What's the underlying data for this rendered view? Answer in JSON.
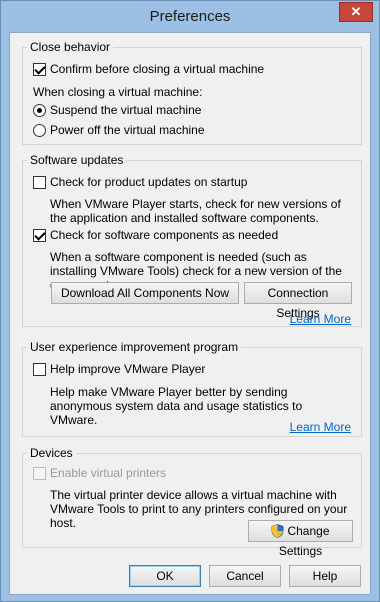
{
  "window": {
    "title": "Preferences",
    "close_glyph": "✕"
  },
  "close_behavior": {
    "title": "Close behavior",
    "confirm_label": "Confirm before closing a virtual machine",
    "confirm_checked": true,
    "when_closing_label": "When closing a virtual machine:",
    "suspend_label": "Suspend the virtual machine",
    "suspend_selected": true,
    "power_off_label": "Power off the virtual machine",
    "power_off_selected": false
  },
  "software_updates": {
    "title": "Software updates",
    "check_product_label": "Check for product updates on startup",
    "check_product_checked": false,
    "check_product_desc": "When VMware Player starts, check for new versions of the application and installed software components.",
    "check_components_label": "Check for software components as needed",
    "check_components_checked": true,
    "check_components_desc": "When a software component is needed (such as installing VMware Tools) check for a new version of the component.",
    "download_button": "Download All Components Now",
    "connection_button": "Connection Settings",
    "learn_more": "Learn More"
  },
  "ux_program": {
    "title": "User experience improvement program",
    "help_label": "Help improve VMware Player",
    "help_checked": false,
    "help_desc": "Help make VMware Player better by sending anonymous system data and usage statistics to VMware.",
    "learn_more": "Learn More"
  },
  "devices": {
    "title": "Devices",
    "enable_printers_label": "Enable virtual printers",
    "enable_printers_checked": false,
    "enable_printers_disabled": true,
    "printers_desc": "The virtual printer device allows a virtual machine with VMware Tools to print to any printers configured on your host.",
    "change_settings_button": "Change Settings",
    "change_settings_icon": "uac-shield-icon"
  },
  "footer": {
    "ok": "OK",
    "cancel": "Cancel",
    "help": "Help"
  },
  "colors": {
    "frame": "#9cc0e3",
    "client": "#f0f0f0",
    "link": "#0066cc",
    "close": "#c7463b"
  }
}
